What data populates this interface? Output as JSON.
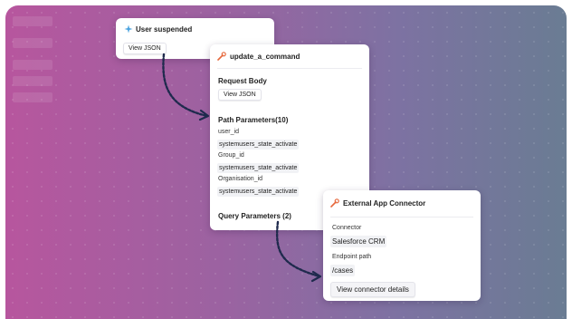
{
  "card_user": {
    "title": "User suspended",
    "button": "View JSON"
  },
  "card_update": {
    "title": "update_a_command",
    "request_body_heading": "Request Body",
    "request_body_button": "View JSON",
    "path_params_heading": "Path Parameters(10)",
    "params": [
      {
        "name": "user_id",
        "value": "systemusers_state_activate"
      },
      {
        "name": "Group_id",
        "value": "systemusers_state_activate"
      },
      {
        "name": "Organisation_id",
        "value": "systemusers_state_activate"
      }
    ],
    "query_params_heading": "Query Parameters (2)"
  },
  "card_connector": {
    "title": "External App Connector",
    "connector_label": "Connector",
    "connector_value": "Salesforce CRM",
    "endpoint_label": "Endpoint path",
    "endpoint_value": "/cases",
    "button": "View connector details"
  },
  "colors": {
    "lightning_icon": "#4aa3df",
    "wrench_icon": "#e6683c",
    "arrow": "#1f2a4d"
  }
}
